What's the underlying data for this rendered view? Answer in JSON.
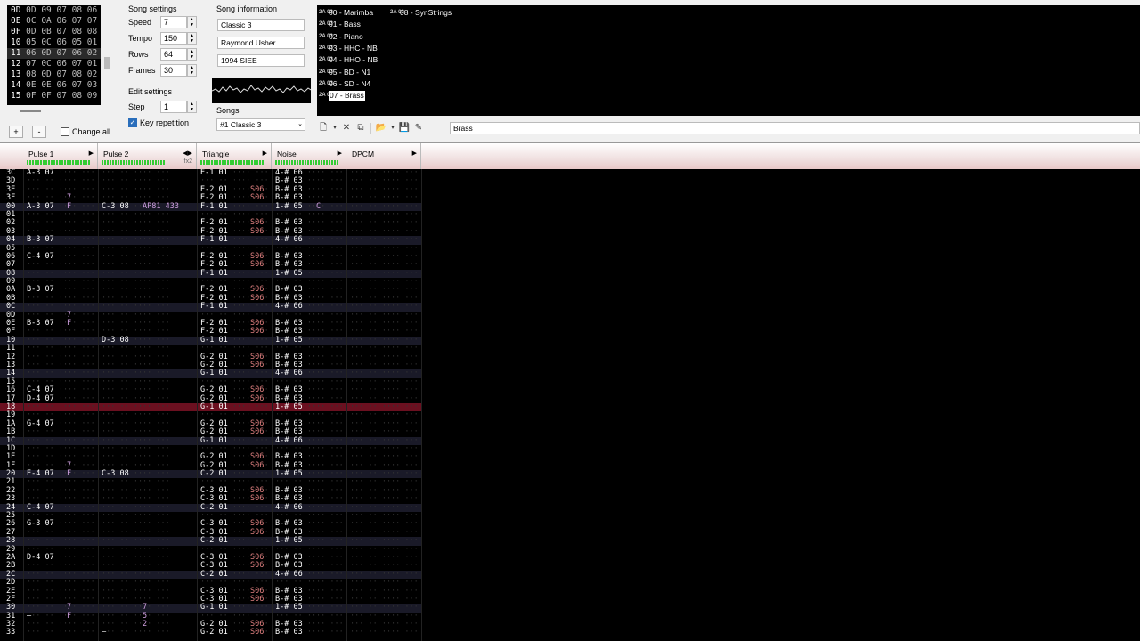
{
  "frames": {
    "rows": [
      {
        "id": "0D",
        "cells": "0D 09 07 08 06"
      },
      {
        "id": "0E",
        "cells": "0C 0A 06 07 07"
      },
      {
        "id": "0F",
        "cells": "0D 0B 07 08 08"
      },
      {
        "id": "10",
        "cells": "05 0C 06 05 01"
      },
      {
        "id": "11",
        "cells": "06 0D 07 06 02"
      },
      {
        "id": "12",
        "cells": "07 0C 06 07 01"
      },
      {
        "id": "13",
        "cells": "08 0D 07 08 02"
      },
      {
        "id": "14",
        "cells": "0E 0E 06 07 03"
      },
      {
        "id": "15",
        "cells": "0F 0F 07 08 09"
      }
    ],
    "add_label": "+",
    "remove_label": "-",
    "change_all_label": "Change all"
  },
  "song_settings": {
    "title": "Song settings",
    "speed_label": "Speed",
    "speed": "7",
    "tempo_label": "Tempo",
    "tempo": "150",
    "rows_label": "Rows",
    "rows": "64",
    "frames_label": "Frames",
    "frames": "30"
  },
  "edit_settings": {
    "title": "Edit settings",
    "step_label": "Step",
    "step": "1",
    "key_repetition_label": "Key repetition"
  },
  "song_information": {
    "title": "Song information",
    "name": "Classic 3",
    "artist": "Raymond Usher",
    "copyright": "1994 SIEE"
  },
  "songs": {
    "title": "Songs",
    "selected": "#1 Classic 3"
  },
  "instruments": [
    {
      "label": "00 - Marimba"
    },
    {
      "label": "01 - Bass"
    },
    {
      "label": "02 - Piano"
    },
    {
      "label": "03 - HHC - NB"
    },
    {
      "label": "04 - HHO - NB"
    },
    {
      "label": "05 - BD - N1"
    },
    {
      "label": "06 - SD - N4"
    },
    {
      "label": "07 - Brass"
    },
    {
      "label": "08 - SynStrings"
    }
  ],
  "instrument_name": "Brass",
  "channels": [
    {
      "name": "Pulse 1",
      "arrows": "▶"
    },
    {
      "name": "Pulse 2",
      "arrows": "◀▶",
      "fx": "fx2"
    },
    {
      "name": "Triangle",
      "arrows": "▶"
    },
    {
      "name": "Noise",
      "arrows": "▶"
    },
    {
      "name": "DPCM",
      "arrows": "▶"
    }
  ],
  "pattern_rows": [
    {
      "n": "3C",
      "p1": "A-3 07",
      "t": "E-1 01",
      "no": "4-# 06"
    },
    {
      "n": "3D",
      "no": "B-# 03"
    },
    {
      "n": "3E",
      "t": "E-2 01",
      "tf": "S06",
      "no": "B-# 03"
    },
    {
      "n": "3F",
      "p1f": "7",
      "t": "E-2 01",
      "tf": "S06",
      "no": "B-# 03"
    },
    {
      "n": "00",
      "p1": "A-3 07",
      "p1f": "F",
      "p2": "C-3 08",
      "p2f": "AP81 433",
      "t": "F-1 01",
      "no": "1-# 05",
      "nof": "C",
      "hl": true
    },
    {
      "n": "01"
    },
    {
      "n": "02",
      "t": "F-2 01",
      "tf": "S06",
      "no": "B-# 03"
    },
    {
      "n": "03",
      "t": "F-2 01",
      "tf": "S06",
      "no": "B-# 03"
    },
    {
      "n": "04",
      "p1": "B-3 07",
      "t": "F-1 01",
      "no": "4-# 06",
      "hl": true
    },
    {
      "n": "05"
    },
    {
      "n": "06",
      "p1": "C-4 07",
      "t": "F-2 01",
      "tf": "S06",
      "no": "B-# 03"
    },
    {
      "n": "07",
      "t": "F-2 01",
      "tf": "S06",
      "no": "B-# 03"
    },
    {
      "n": "08",
      "t": "F-1 01",
      "no": "1-# 05",
      "hl": true
    },
    {
      "n": "09"
    },
    {
      "n": "0A",
      "p1": "B-3 07",
      "t": "F-2 01",
      "tf": "S06",
      "no": "B-# 03"
    },
    {
      "n": "0B",
      "t": "F-2 01",
      "tf": "S06",
      "no": "B-# 03"
    },
    {
      "n": "0C",
      "t": "F-1 01",
      "no": "4-# 06",
      "hl": true
    },
    {
      "n": "0D",
      "p1f": "7"
    },
    {
      "n": "0E",
      "p1": "B-3 07",
      "p1f": "F",
      "t": "F-2 01",
      "tf": "S06",
      "no": "B-# 03"
    },
    {
      "n": "0F",
      "t": "F-2 01",
      "tf": "S06",
      "no": "B-# 03"
    },
    {
      "n": "10",
      "p2": "D-3 08",
      "t": "G-1 01",
      "no": "1-# 05",
      "hl": true
    },
    {
      "n": "11"
    },
    {
      "n": "12",
      "t": "G-2 01",
      "tf": "S06",
      "no": "B-# 03"
    },
    {
      "n": "13",
      "t": "G-2 01",
      "tf": "S06",
      "no": "B-# 03"
    },
    {
      "n": "14",
      "t": "G-1 01",
      "no": "4-# 06",
      "hl": true
    },
    {
      "n": "15"
    },
    {
      "n": "16",
      "p1": "C-4 07",
      "t": "G-2 01",
      "tf": "S06",
      "no": "B-# 03"
    },
    {
      "n": "17",
      "p1": "D-4 07",
      "t": "G-2 01",
      "tf": "S06",
      "no": "B-# 03"
    },
    {
      "n": "18",
      "t": "G-1 01",
      "no": "1-# 05",
      "cur": true
    },
    {
      "n": "19"
    },
    {
      "n": "1A",
      "p1": "G-4 07",
      "t": "G-2 01",
      "tf": "S06",
      "no": "B-# 03"
    },
    {
      "n": "1B",
      "t": "G-2 01",
      "tf": "S06",
      "no": "B-# 03"
    },
    {
      "n": "1C",
      "t": "G-1 01",
      "no": "4-# 06",
      "hl": true
    },
    {
      "n": "1D"
    },
    {
      "n": "1E",
      "t": "G-2 01",
      "tf": "S06",
      "no": "B-# 03"
    },
    {
      "n": "1F",
      "p1f": "7",
      "t": "G-2 01",
      "tf": "S06",
      "no": "B-# 03"
    },
    {
      "n": "20",
      "p1": "E-4 07",
      "p1f": "F",
      "p2": "C-3 08",
      "t": "C-2 01",
      "no": "1-# 05",
      "hl": true
    },
    {
      "n": "21"
    },
    {
      "n": "22",
      "t": "C-3 01",
      "tf": "S06",
      "no": "B-# 03"
    },
    {
      "n": "23",
      "t": "C-3 01",
      "tf": "S06",
      "no": "B-# 03"
    },
    {
      "n": "24",
      "p1": "C-4 07",
      "t": "C-2 01",
      "no": "4-# 06",
      "hl": true
    },
    {
      "n": "25"
    },
    {
      "n": "26",
      "p1": "G-3 07",
      "t": "C-3 01",
      "tf": "S06",
      "no": "B-# 03"
    },
    {
      "n": "27",
      "t": "C-3 01",
      "tf": "S06",
      "no": "B-# 03"
    },
    {
      "n": "28",
      "t": "C-2 01",
      "no": "1-# 05",
      "hl": true
    },
    {
      "n": "29"
    },
    {
      "n": "2A",
      "p1": "D-4 07",
      "t": "C-3 01",
      "tf": "S06",
      "no": "B-# 03"
    },
    {
      "n": "2B",
      "t": "C-3 01",
      "tf": "S06",
      "no": "B-# 03"
    },
    {
      "n": "2C",
      "t": "C-2 01",
      "no": "4-# 06",
      "hl": true
    },
    {
      "n": "2D"
    },
    {
      "n": "2E",
      "t": "C-3 01",
      "tf": "S06",
      "no": "B-# 03"
    },
    {
      "n": "2F",
      "t": "C-3 01",
      "tf": "S06",
      "no": "B-# 03"
    },
    {
      "n": "30",
      "p1f": "7",
      "p2f": "7",
      "t": "G-1 01",
      "no": "1-# 05",
      "hl": true
    },
    {
      "n": "31",
      "p1": "—",
      "p1f": "F",
      "p2f": "5"
    },
    {
      "n": "32",
      "p2f": "2",
      "t": "G-2 01",
      "tf": "S06",
      "no": "B-# 03"
    },
    {
      "n": "33",
      "p2": "—",
      "t": "G-2 01",
      "tf": "S06",
      "no": "B-# 03"
    }
  ]
}
